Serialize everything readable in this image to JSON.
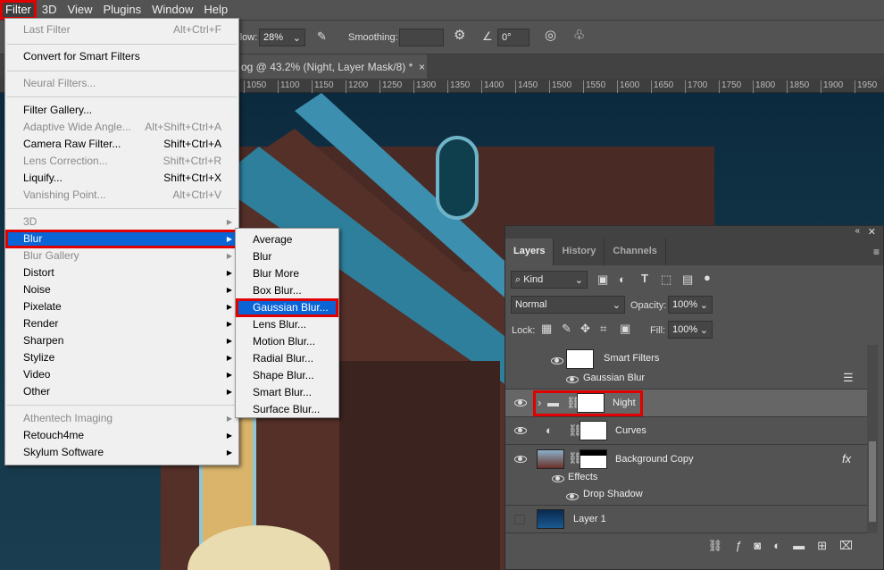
{
  "menubar": [
    "Filter",
    "3D",
    "View",
    "Plugins",
    "Window",
    "Help"
  ],
  "options": {
    "flow_label": "Flow:",
    "flow_value": "28%",
    "smoothing_label": "Smoothing:",
    "angle_value": "0°"
  },
  "doc_tab": {
    "title": "og @ 43.2% (Night, Layer Mask/8) *",
    "close": "×"
  },
  "ruler": [
    "1050",
    "1100",
    "1150",
    "1200",
    "1250",
    "1300",
    "1350",
    "1400",
    "1450",
    "1500",
    "1550",
    "1600",
    "1650",
    "1700",
    "1750",
    "1800",
    "1850",
    "1900",
    "1950"
  ],
  "filter_menu": {
    "last_filter": {
      "label": "Last Filter",
      "shortcut": "Alt+Ctrl+F"
    },
    "convert": "Convert for Smart Filters",
    "neural": "Neural Filters...",
    "gallery": "Filter Gallery...",
    "adaptive": {
      "label": "Adaptive Wide Angle...",
      "shortcut": "Alt+Shift+Ctrl+A"
    },
    "camera_raw": {
      "label": "Camera Raw Filter...",
      "shortcut": "Shift+Ctrl+A"
    },
    "lens": {
      "label": "Lens Correction...",
      "shortcut": "Shift+Ctrl+R"
    },
    "liquify": {
      "label": "Liquify...",
      "shortcut": "Shift+Ctrl+X"
    },
    "vanishing": {
      "label": "Vanishing Point...",
      "shortcut": "Alt+Ctrl+V"
    },
    "groups": [
      "3D",
      "Blur",
      "Blur Gallery",
      "Distort",
      "Noise",
      "Pixelate",
      "Render",
      "Sharpen",
      "Stylize",
      "Video",
      "Other"
    ],
    "plugins": [
      "Athentech Imaging",
      "Retouch4me",
      "Skylum Software"
    ]
  },
  "blur_submenu": [
    "Average",
    "Blur",
    "Blur More",
    "Box Blur...",
    "Gaussian Blur...",
    "Lens Blur...",
    "Motion Blur...",
    "Radial Blur...",
    "Shape Blur...",
    "Smart Blur...",
    "Surface Blur..."
  ],
  "layers_panel": {
    "tabs": [
      "Layers",
      "History",
      "Channels"
    ],
    "filter_kind": "Kind",
    "blend_mode": "Normal",
    "opacity_label": "Opacity:",
    "opacity": "100%",
    "lock_label": "Lock:",
    "fill_label": "Fill:",
    "fill": "100%",
    "layers": {
      "smart_filters": "Smart Filters",
      "gaussian": "Gaussian Blur",
      "night": "Night",
      "curves": "Curves",
      "bg_copy": "Background Copy",
      "fx": "fx",
      "effects": "Effects",
      "drop_shadow": "Drop Shadow",
      "layer1": "Layer 1"
    }
  }
}
